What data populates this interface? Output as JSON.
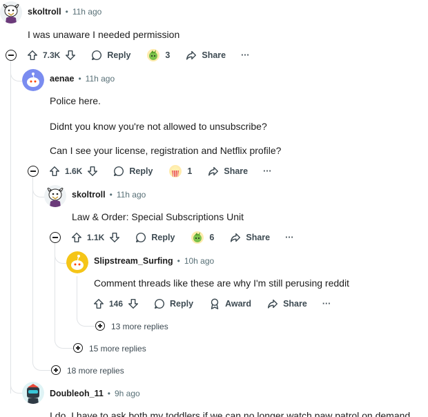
{
  "colors": {
    "accent": "#576f76",
    "thread_line": "#e0e3e6",
    "text": "#1c1c1c"
  },
  "comments": [
    {
      "author": "skoltroll",
      "time": "11h ago",
      "lines": [
        "I was unaware I needed permission"
      ],
      "votes": "7.3K",
      "reply_label": "Reply",
      "award_count": "3",
      "share_label": "Share",
      "more_label": "···"
    },
    {
      "author": "aenae",
      "time": "11h ago",
      "lines": [
        "Police here.",
        "Didnt you know you're not allowed to unsubscribe?",
        "Can I see your license, registration and Netflix profile?"
      ],
      "votes": "1.6K",
      "reply_label": "Reply",
      "award_count": "1",
      "share_label": "Share",
      "more_label": "···"
    },
    {
      "author": "skoltroll",
      "time": "11h ago",
      "lines": [
        "Law & Order: Special Subscriptions Unit"
      ],
      "votes": "1.1K",
      "reply_label": "Reply",
      "award_count": "6",
      "share_label": "Share",
      "more_label": "···"
    },
    {
      "author": "Slipstream_Surfing",
      "time": "10h ago",
      "lines": [
        "Comment threads like these are why I'm still perusing reddit"
      ],
      "votes": "146",
      "reply_label": "Reply",
      "award_label": "Award",
      "share_label": "Share",
      "more_label": "···"
    },
    {
      "author": "Doubleoh_11",
      "time": "9h ago",
      "lines": [
        "I do. I have to ask both my toddlers if we can no longer watch paw patrol on demand"
      ]
    }
  ],
  "more_replies": [
    "13 more replies",
    "15 more replies",
    "18 more replies"
  ],
  "separator": "•"
}
